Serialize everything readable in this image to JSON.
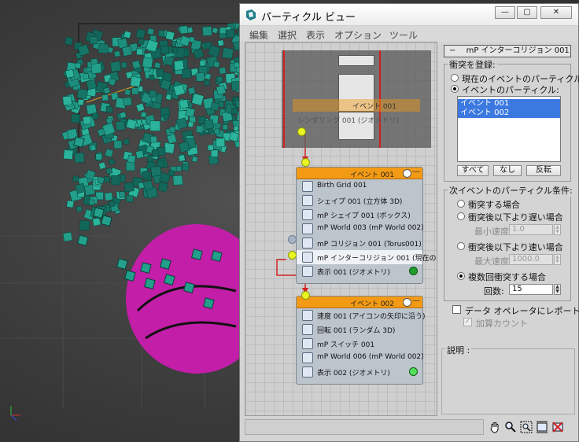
{
  "window": {
    "title": "パーティクル ビュー",
    "controls": {
      "minimize": "—",
      "restore": "▢",
      "close": "✕"
    }
  },
  "menu": [
    "編集",
    "選択",
    "表示",
    "オプション",
    "ツール"
  ],
  "events": [
    {
      "title": "イベント 001",
      "operators": [
        {
          "label": "Birth Grid 001",
          "icon": "birth-icon"
        },
        {
          "label": "シェイプ 001 (立方体 3D)",
          "icon": "shape-icon"
        },
        {
          "label": "mP シェイプ 001 (ボックス)",
          "icon": "mp-shape-icon"
        },
        {
          "label": "mP World 003 (mP World 002)",
          "icon": "mp-world-icon"
        },
        {
          "label": "mP コリジョン 001 (Torus001)",
          "icon": "mp-collision-icon"
        },
        {
          "label": "mP インターコリジョン 001 (現在の…",
          "icon": "mp-intercollision-icon",
          "selected": true
        },
        {
          "label": "表示 001 (ジオメトリ)",
          "icon": "display-icon",
          "led": "#1e9e2a"
        }
      ]
    },
    {
      "title": "イベント 002",
      "operators": [
        {
          "label": "速度 001 (アイコンの矢印に沿う)",
          "icon": "speed-icon"
        },
        {
          "label": "回転 001 (ランダム 3D)",
          "icon": "rotation-icon"
        },
        {
          "label": "mP スイッチ  001",
          "icon": "mp-switch-icon"
        },
        {
          "label": "mP World 006 (mP World 002)",
          "icon": "mp-world-icon"
        },
        {
          "label": "表示 002 (ジオメトリ)",
          "icon": "display-icon",
          "led": "#55e05a"
        }
      ]
    }
  ],
  "overlay_event": {
    "title": "イベント 001",
    "operator": "レンダリング 001 (ジオメトリ)"
  },
  "panel": {
    "rollout_title": "mP インターコリジョン 001",
    "rollout_prefix": "−",
    "collide_group": {
      "label": "衝突を登録:",
      "options": [
        "現在のイベントのパーティクル",
        "イベントのパーティクル:"
      ],
      "selected_index": 1,
      "list": [
        "イベント 001",
        "イベント 002"
      ],
      "buttons": [
        "すべて",
        "なし",
        "反転"
      ]
    },
    "condition_group": {
      "label": "次イベントのパーティクル条件:",
      "options": [
        "衝突する場合",
        "衝突後以下より遅い場合",
        "衝突後以下より速い場合",
        "複数回衝突する場合"
      ],
      "selected_index": 3,
      "min_speed_label": "最小速度:",
      "min_speed_value": "1.0",
      "max_speed_label": "最大速度:",
      "max_speed_value": "1000.0",
      "count_label": "回数:",
      "count_value": "15"
    },
    "report_checkbox": "データ オペレータにレポート",
    "accumulate_checkbox": "加算カウント",
    "description_label": "説明 :"
  },
  "colors": {
    "event_header": "#f39a15",
    "selection": "#3b79e0",
    "particles": "#1e8f7e",
    "sphere": "#c21ea8"
  }
}
